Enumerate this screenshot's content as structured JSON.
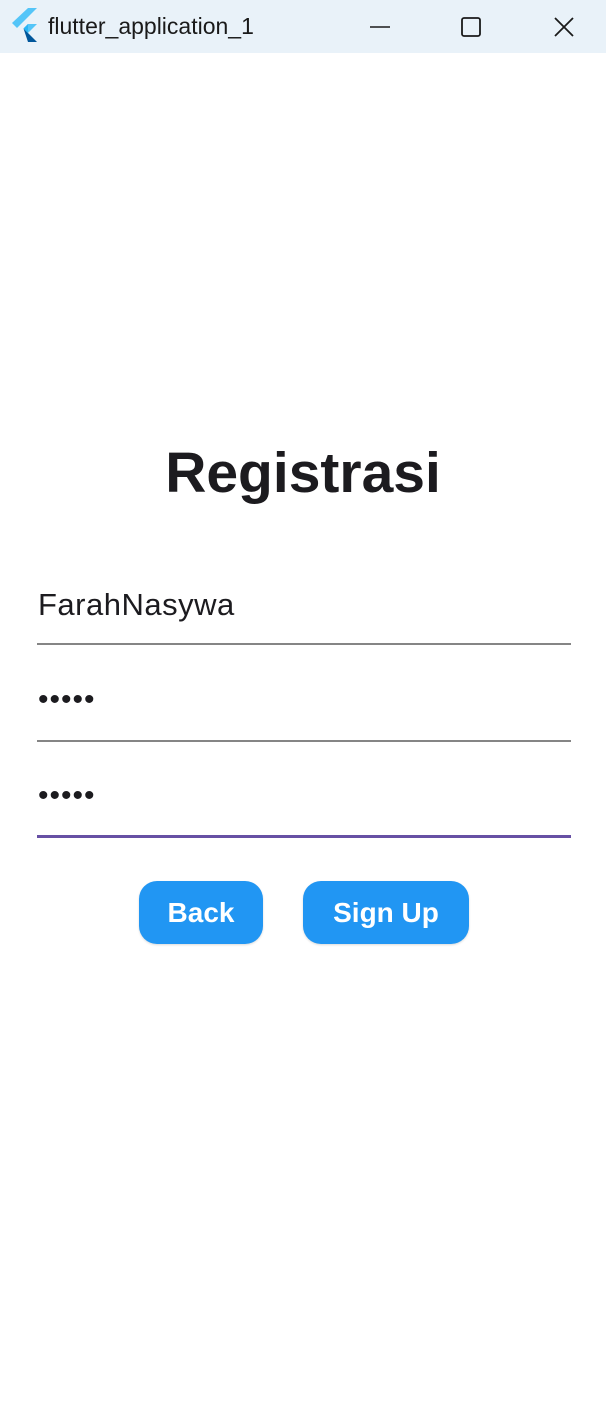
{
  "window": {
    "title": "flutter_application_1",
    "app_icon": "flutter-logo-icon",
    "controls": {
      "minimize_icon": "minimize-icon",
      "maximize_icon": "maximize-icon",
      "close_icon": "close-icon"
    }
  },
  "form": {
    "heading": "Registrasi",
    "username_value": "FarahNasywa",
    "password_value": "•••••",
    "confirm_password_value": "•••••",
    "focused_accent": "#6750a4"
  },
  "buttons": {
    "back_label": "Back",
    "signup_label": "Sign Up",
    "color": "#2196f3"
  }
}
